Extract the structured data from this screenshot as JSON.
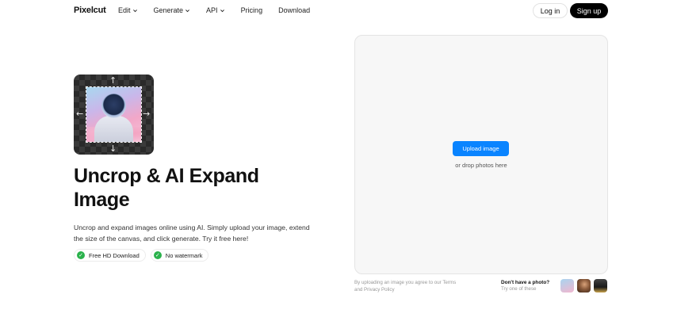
{
  "nav": {
    "logo": "Pixelcut",
    "menu": [
      {
        "label": "Edit",
        "has_dropdown": true
      },
      {
        "label": "Generate",
        "has_dropdown": true
      },
      {
        "label": "API",
        "has_dropdown": true
      },
      {
        "label": "Pricing",
        "has_dropdown": false
      },
      {
        "label": "Download",
        "has_dropdown": false
      }
    ],
    "login_label": "Log in",
    "signup_label": "Sign up"
  },
  "hero": {
    "title": "Uncrop & AI Expand Image",
    "description": "Uncrop and expand images online using AI. Simply upload your image, extend the size of the canvas, and click generate. Try it free here!",
    "badges": [
      {
        "label": "Free HD Download"
      },
      {
        "label": "No watermark"
      }
    ],
    "preview_arrows": [
      "↑",
      "↓",
      "←",
      "→"
    ]
  },
  "upload": {
    "button_label": "Upload image",
    "drop_text": "or drop photos here",
    "terms_text": "By uploading an image you agree to our Terms and Privacy Policy",
    "no_photo_title": "Don't have a photo?",
    "no_photo_sub": "Try one of these"
  },
  "colors": {
    "accent": "#0a84ff",
    "check_green": "#2bb24c",
    "signup_bg": "#000000",
    "panel_bg": "#f7f7f7"
  }
}
